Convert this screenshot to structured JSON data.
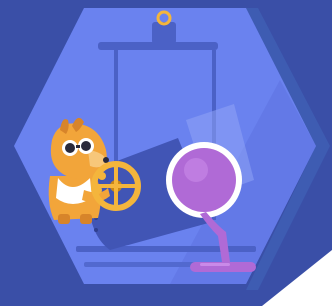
{
  "scene": {
    "subject": "dog-operating-crucible-wheel",
    "colors": {
      "page_background": "#ffffff",
      "dark_panel": "#3a4fa7",
      "hexagon_fill": "#6a82ef",
      "hexagon_shade": "#5c73e0",
      "hexagon_right_edge": "#3e5cb2",
      "crucible_body": "#4155b5",
      "crucible_glow": "#8fa4f5",
      "molten_liquid": "#b06ad6",
      "molten_liquid_light": "#c98ae8",
      "dog_fur": "#f2a53a",
      "dog_fur_dark": "#d7842a",
      "goggles": "#2a2a3a",
      "goggle_frame": "#ffffff",
      "wheel": "#f4b53c",
      "wheel_dark": "#c98716",
      "frame_rail": "#4b61c6",
      "hook": "#f4b53c"
    },
    "icons": [
      "crane-hook-icon",
      "steering-wheel-icon",
      "crucible-icon"
    ]
  }
}
